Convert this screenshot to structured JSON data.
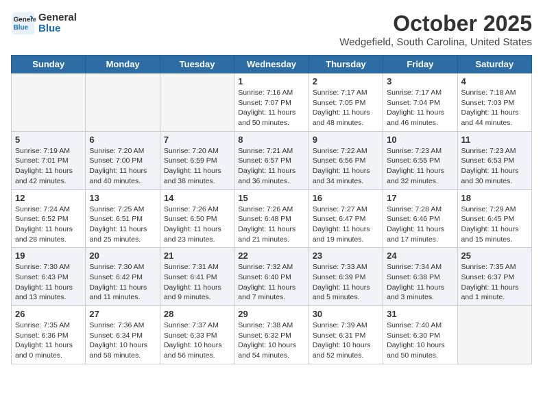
{
  "logo": {
    "line1": "General",
    "line2": "Blue"
  },
  "title": "October 2025",
  "location": "Wedgefield, South Carolina, United States",
  "weekdays": [
    "Sunday",
    "Monday",
    "Tuesday",
    "Wednesday",
    "Thursday",
    "Friday",
    "Saturday"
  ],
  "rows": [
    [
      {
        "day": "",
        "text": ""
      },
      {
        "day": "",
        "text": ""
      },
      {
        "day": "",
        "text": ""
      },
      {
        "day": "1",
        "text": "Sunrise: 7:16 AM\nSunset: 7:07 PM\nDaylight: 11 hours\nand 50 minutes."
      },
      {
        "day": "2",
        "text": "Sunrise: 7:17 AM\nSunset: 7:05 PM\nDaylight: 11 hours\nand 48 minutes."
      },
      {
        "day": "3",
        "text": "Sunrise: 7:17 AM\nSunset: 7:04 PM\nDaylight: 11 hours\nand 46 minutes."
      },
      {
        "day": "4",
        "text": "Sunrise: 7:18 AM\nSunset: 7:03 PM\nDaylight: 11 hours\nand 44 minutes."
      }
    ],
    [
      {
        "day": "5",
        "text": "Sunrise: 7:19 AM\nSunset: 7:01 PM\nDaylight: 11 hours\nand 42 minutes."
      },
      {
        "day": "6",
        "text": "Sunrise: 7:20 AM\nSunset: 7:00 PM\nDaylight: 11 hours\nand 40 minutes."
      },
      {
        "day": "7",
        "text": "Sunrise: 7:20 AM\nSunset: 6:59 PM\nDaylight: 11 hours\nand 38 minutes."
      },
      {
        "day": "8",
        "text": "Sunrise: 7:21 AM\nSunset: 6:57 PM\nDaylight: 11 hours\nand 36 minutes."
      },
      {
        "day": "9",
        "text": "Sunrise: 7:22 AM\nSunset: 6:56 PM\nDaylight: 11 hours\nand 34 minutes."
      },
      {
        "day": "10",
        "text": "Sunrise: 7:23 AM\nSunset: 6:55 PM\nDaylight: 11 hours\nand 32 minutes."
      },
      {
        "day": "11",
        "text": "Sunrise: 7:23 AM\nSunset: 6:53 PM\nDaylight: 11 hours\nand 30 minutes."
      }
    ],
    [
      {
        "day": "12",
        "text": "Sunrise: 7:24 AM\nSunset: 6:52 PM\nDaylight: 11 hours\nand 28 minutes."
      },
      {
        "day": "13",
        "text": "Sunrise: 7:25 AM\nSunset: 6:51 PM\nDaylight: 11 hours\nand 25 minutes."
      },
      {
        "day": "14",
        "text": "Sunrise: 7:26 AM\nSunset: 6:50 PM\nDaylight: 11 hours\nand 23 minutes."
      },
      {
        "day": "15",
        "text": "Sunrise: 7:26 AM\nSunset: 6:48 PM\nDaylight: 11 hours\nand 21 minutes."
      },
      {
        "day": "16",
        "text": "Sunrise: 7:27 AM\nSunset: 6:47 PM\nDaylight: 11 hours\nand 19 minutes."
      },
      {
        "day": "17",
        "text": "Sunrise: 7:28 AM\nSunset: 6:46 PM\nDaylight: 11 hours\nand 17 minutes."
      },
      {
        "day": "18",
        "text": "Sunrise: 7:29 AM\nSunset: 6:45 PM\nDaylight: 11 hours\nand 15 minutes."
      }
    ],
    [
      {
        "day": "19",
        "text": "Sunrise: 7:30 AM\nSunset: 6:43 PM\nDaylight: 11 hours\nand 13 minutes."
      },
      {
        "day": "20",
        "text": "Sunrise: 7:30 AM\nSunset: 6:42 PM\nDaylight: 11 hours\nand 11 minutes."
      },
      {
        "day": "21",
        "text": "Sunrise: 7:31 AM\nSunset: 6:41 PM\nDaylight: 11 hours\nand 9 minutes."
      },
      {
        "day": "22",
        "text": "Sunrise: 7:32 AM\nSunset: 6:40 PM\nDaylight: 11 hours\nand 7 minutes."
      },
      {
        "day": "23",
        "text": "Sunrise: 7:33 AM\nSunset: 6:39 PM\nDaylight: 11 hours\nand 5 minutes."
      },
      {
        "day": "24",
        "text": "Sunrise: 7:34 AM\nSunset: 6:38 PM\nDaylight: 11 hours\nand 3 minutes."
      },
      {
        "day": "25",
        "text": "Sunrise: 7:35 AM\nSunset: 6:37 PM\nDaylight: 11 hours\nand 1 minute."
      }
    ],
    [
      {
        "day": "26",
        "text": "Sunrise: 7:35 AM\nSunset: 6:36 PM\nDaylight: 11 hours\nand 0 minutes."
      },
      {
        "day": "27",
        "text": "Sunrise: 7:36 AM\nSunset: 6:34 PM\nDaylight: 10 hours\nand 58 minutes."
      },
      {
        "day": "28",
        "text": "Sunrise: 7:37 AM\nSunset: 6:33 PM\nDaylight: 10 hours\nand 56 minutes."
      },
      {
        "day": "29",
        "text": "Sunrise: 7:38 AM\nSunset: 6:32 PM\nDaylight: 10 hours\nand 54 minutes."
      },
      {
        "day": "30",
        "text": "Sunrise: 7:39 AM\nSunset: 6:31 PM\nDaylight: 10 hours\nand 52 minutes."
      },
      {
        "day": "31",
        "text": "Sunrise: 7:40 AM\nSunset: 6:30 PM\nDaylight: 10 hours\nand 50 minutes."
      },
      {
        "day": "",
        "text": ""
      }
    ]
  ]
}
